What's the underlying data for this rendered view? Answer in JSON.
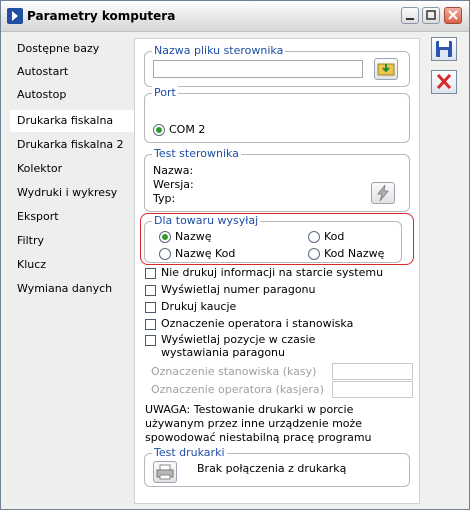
{
  "window": {
    "title": "Parametry komputera"
  },
  "nav": {
    "items": [
      {
        "label": "Dostępne bazy"
      },
      {
        "label": "Autostart"
      },
      {
        "label": "Autostop"
      },
      {
        "label": "Drukarka fiskalna"
      },
      {
        "label": "Drukarka fiskalna 2"
      },
      {
        "label": "Kolektor"
      },
      {
        "label": "Wydruki i wykresy"
      },
      {
        "label": "Eksport"
      },
      {
        "label": "Filtry"
      },
      {
        "label": "Klucz"
      },
      {
        "label": "Wymiana danych"
      }
    ],
    "active_index": 3
  },
  "driver": {
    "legend": "Nazwa pliku sterownika",
    "value": ""
  },
  "port": {
    "legend": "Port",
    "option": "COM 2"
  },
  "test_driver": {
    "legend": "Test sterownika",
    "name_label": "Nazwa:",
    "version_label": "Wersja:",
    "type_label": "Typ:"
  },
  "send_for_item": {
    "legend": "Dla towaru wysyłaj",
    "options": [
      "Nazwę",
      "Kod",
      "Nazwę Kod",
      "Kod Nazwę"
    ],
    "selected": "Nazwę"
  },
  "checkboxes": {
    "no_print_info": "Nie drukuj informacji na starcie systemu",
    "show_receipt_number": "Wyświetlaj numer paragonu",
    "print_deposits": "Drukuj kaucje",
    "operator_station": "Oznaczenie operatora i stanowiska",
    "show_items_line1": "Wyświetlaj pozycje w czasie",
    "show_items_line2": "wystawiania paragonu"
  },
  "labels": {
    "station_mark": "Oznaczenie stanowiska (kasy)",
    "operator_mark": "Oznaczenie operatora (kasjera)"
  },
  "warning": {
    "line1": "UWAGA: Testowanie drukarki w porcie",
    "line2": "używanym przez inne urządzenie może",
    "line3": "spowodować niestabilną pracę programu"
  },
  "printer_test": {
    "legend": "Test drukarki",
    "status": "Brak połączenia z drukarką"
  },
  "colors": {
    "accent": "#1e4ea3",
    "highlight": "#d8262b",
    "radio_dot": "#2f9a2f"
  }
}
